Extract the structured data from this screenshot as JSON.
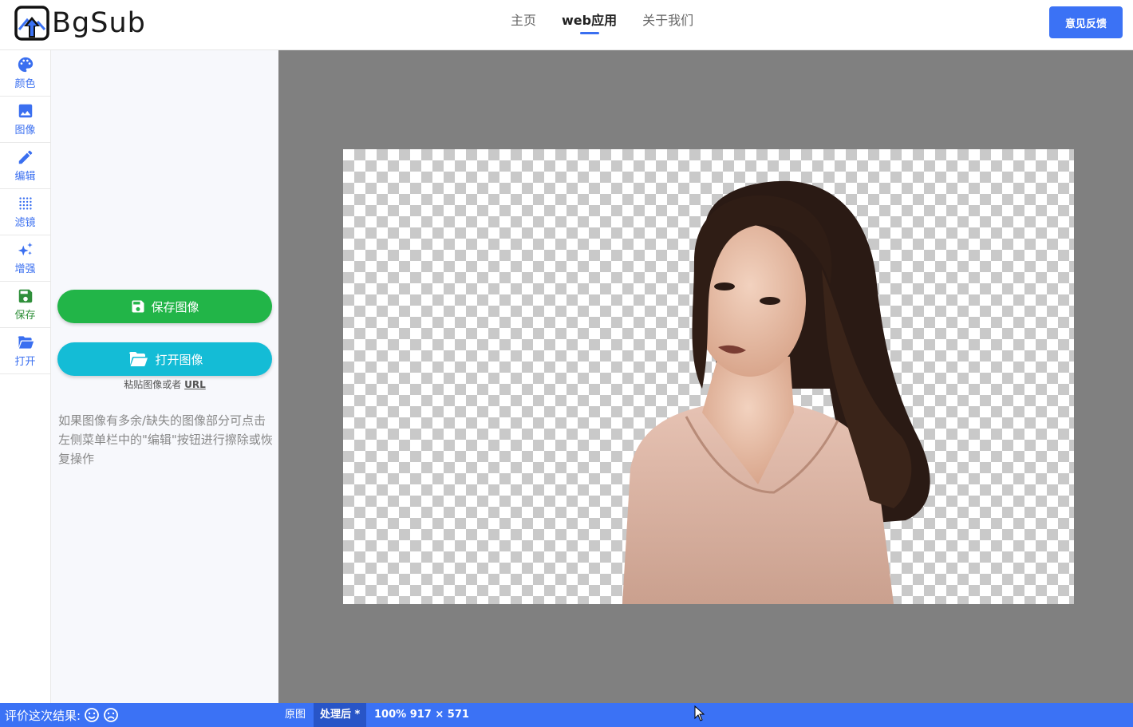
{
  "app": {
    "name": "BgSub"
  },
  "nav": {
    "items": [
      {
        "label": "主页"
      },
      {
        "label": "web应用"
      },
      {
        "label": "关于我们"
      }
    ],
    "active": 1
  },
  "header": {
    "feedback_label": "意见反馈"
  },
  "sidebar": {
    "items": [
      {
        "label": "颜色",
        "icon": "palette-icon"
      },
      {
        "label": "图像",
        "icon": "image-icon"
      },
      {
        "label": "编辑",
        "icon": "pencil-icon"
      },
      {
        "label": "滤镜",
        "icon": "dots-grid-icon"
      },
      {
        "label": "增强",
        "icon": "sparkles-icon"
      },
      {
        "label": "保存",
        "icon": "floppy-icon"
      },
      {
        "label": "打开",
        "icon": "folder-open-icon"
      }
    ]
  },
  "panel": {
    "save_label": "保存图像",
    "open_label": "打开图像",
    "paste_prefix": "粘贴图像或者",
    "paste_url": "URL",
    "tip": "如果图像有多余/缺失的图像部分可点击左侧菜单栏中的\"编辑\"按钮进行擦除或恢复操作"
  },
  "status": {
    "rate_label": "评价这次结果:",
    "original_label": "原图",
    "processed_label": "处理后 *",
    "zoom_info": "100% 917 × 571"
  },
  "colors": {
    "accent": "#3b72f5",
    "save": "#22b548",
    "open": "#14bcd6",
    "canvas_bg": "#808080"
  }
}
